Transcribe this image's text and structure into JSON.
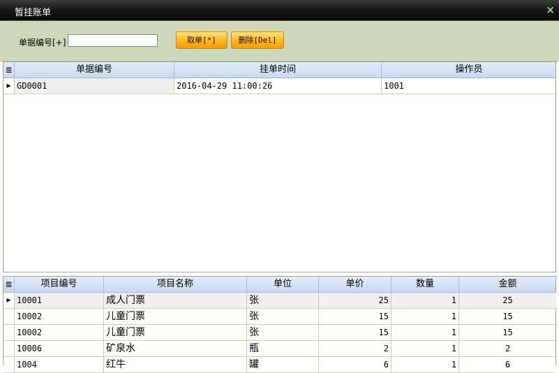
{
  "window": {
    "title": "暂挂账单",
    "close_glyph": "×"
  },
  "toolbar": {
    "doc_no_label": "单据编号[+]",
    "doc_no_value": "",
    "take_button": "取单[*]",
    "delete_button": "删除[Del]"
  },
  "bills": {
    "indicator_header": "≣",
    "columns": [
      "单据编号",
      "挂单时间",
      "操作员"
    ],
    "rows": [
      {
        "doc_no": "GD0001",
        "time": "2016-04-29 11:00:26",
        "operator": "1001"
      }
    ]
  },
  "items": {
    "indicator_header": "≣",
    "columns": [
      "项目编号",
      "项目名称",
      "单位",
      "单价",
      "数量",
      "金额"
    ],
    "rows": [
      {
        "code": "10001",
        "name": "成人门票",
        "unit": "张",
        "price": "25",
        "qty": "1",
        "amount": "25"
      },
      {
        "code": "10002",
        "name": "儿童门票",
        "unit": "张",
        "price": "15",
        "qty": "1",
        "amount": "15"
      },
      {
        "code": "10002",
        "name": "儿童门票",
        "unit": "张",
        "price": "15",
        "qty": "1",
        "amount": "15"
      },
      {
        "code": "10006",
        "name": "矿泉水",
        "unit": "瓶",
        "price": "2",
        "qty": "1",
        "amount": "2"
      },
      {
        "code": "1004",
        "name": "红牛",
        "unit": "罐",
        "price": "6",
        "qty": "1",
        "amount": "6"
      }
    ]
  },
  "row_pointer_glyph": "▶"
}
